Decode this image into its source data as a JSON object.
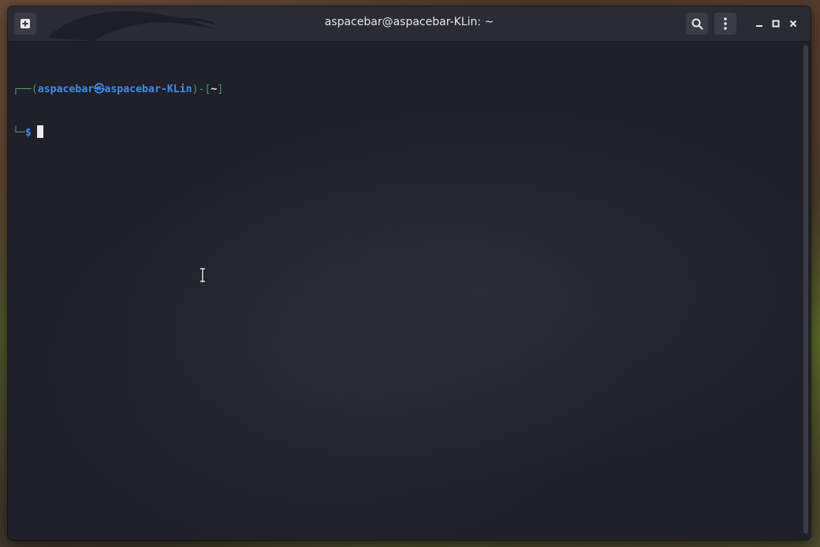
{
  "window": {
    "title": "aspacebar@aspacebar-KLin: ~"
  },
  "titlebar": {
    "new_tab_icon": "new-tab-icon",
    "search_icon": "search-icon",
    "menu_icon": "kebab-menu-icon",
    "minimize_icon": "minimize-icon",
    "maximize_icon": "maximize-icon",
    "close_icon": "close-icon"
  },
  "terminal": {
    "prompt": {
      "line1_open": "┌──(",
      "user": "aspacebar",
      "at_symbol": "㉿",
      "host": "aspacebar-KLin",
      "close_mid": ")-[",
      "cwd": "~",
      "close_bracket": "]",
      "line2_corner": "└─",
      "dollar": "$"
    }
  },
  "colors": {
    "terminal_bg": "#1f2029",
    "titlebar_bg": "#2a2b33",
    "prompt_green": "#4c9a6a",
    "prompt_blue": "#3f8cf0",
    "text": "#e8e8e8"
  }
}
